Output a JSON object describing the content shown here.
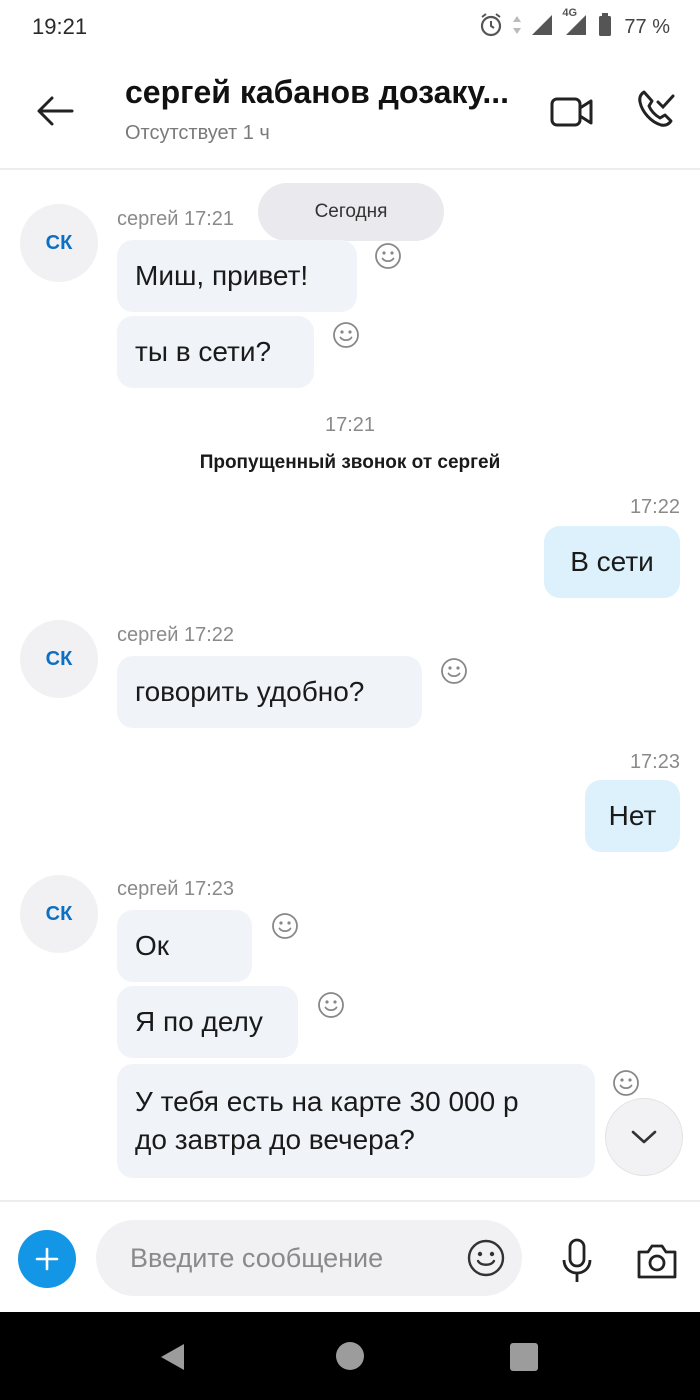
{
  "status_bar": {
    "time": "19:21",
    "battery": "77 %",
    "network": "4G"
  },
  "header": {
    "title": "сергей кабанов дозаку...",
    "subtitle": "Отсутствует 1 ч"
  },
  "chat": {
    "date_chip": "Сегодня",
    "avatar_initials": "СК",
    "groups": [
      {
        "meta": "сергей 17:21",
        "messages": [
          "Миш, привет!",
          "ты в сети?"
        ]
      },
      {
        "meta": "сергей 17:22",
        "messages": [
          "говорить удобно?"
        ]
      },
      {
        "meta": "сергей 17:23",
        "messages": [
          "Ок",
          "Я по делу",
          "У тебя есть на карте 30 000 р",
          "до завтра до вечера?"
        ]
      }
    ],
    "event": {
      "time": "17:21",
      "text": "Пропущенный звонок от сергей"
    },
    "outgoing": [
      {
        "time": "17:22",
        "text": "В сети"
      },
      {
        "time": "17:23",
        "text": "Нет"
      }
    ]
  },
  "composer": {
    "placeholder": "Введите сообщение"
  }
}
